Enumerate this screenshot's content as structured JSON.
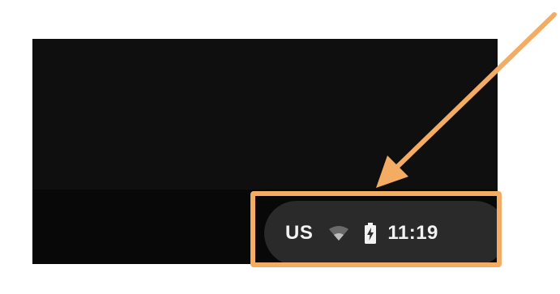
{
  "status_tray": {
    "ime_label": "US",
    "wifi_icon": "wifi-icon",
    "battery_icon": "battery-charging-icon",
    "clock": "11:19"
  },
  "annotation": {
    "highlight_color": "#f4ab62",
    "arrow_color": "#f4ab62"
  },
  "colors": {
    "screen_bg": "#0d0d0d",
    "shelf_bg": "#080808",
    "tray_bg": "#2a2a2a",
    "tray_text": "#f2f2f2"
  }
}
